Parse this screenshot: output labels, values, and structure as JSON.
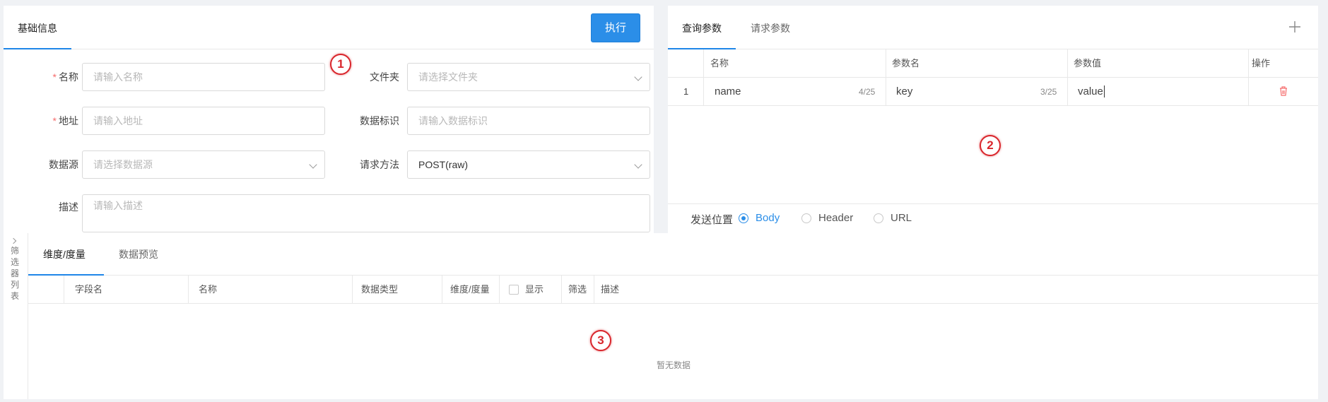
{
  "left_panel": {
    "tab": "基础信息",
    "execute_button": "执行",
    "fields": {
      "name": {
        "label": "名称",
        "required_mark": "*",
        "placeholder": "请输入名称"
      },
      "folder": {
        "label": "文件夹",
        "placeholder": "请选择文件夹"
      },
      "address": {
        "label": "地址",
        "required_mark": "*",
        "placeholder": "请输入地址"
      },
      "data_id": {
        "label": "数据标识",
        "placeholder": "请输入数据标识"
      },
      "datasource": {
        "label": "数据源",
        "placeholder": "请选择数据源"
      },
      "method": {
        "label": "请求方法",
        "value": "POST(raw)"
      },
      "description": {
        "label": "描述",
        "placeholder": "请输入描述"
      }
    }
  },
  "right_panel": {
    "tabs": [
      "查询参数",
      "请求参数"
    ],
    "add_icon": "plus-icon",
    "columns": [
      "名称",
      "参数名",
      "参数值",
      "操作"
    ],
    "rows": [
      {
        "index": "1",
        "name": "name",
        "name_count": "4/25",
        "param": "key",
        "param_count": "3/25",
        "value": "value"
      }
    ],
    "delete_icon": "trash-icon",
    "send_position": {
      "label": "发送位置",
      "options": [
        "Body",
        "Header",
        "URL"
      ],
      "selected": "Body"
    }
  },
  "bottom_panel": {
    "side_toggle": "筛选器列表",
    "tabs": [
      "维度/度量",
      "数据预览"
    ],
    "columns": [
      "字段名",
      "名称",
      "数据类型",
      "维度/度量",
      "显示",
      "筛选",
      "描述"
    ],
    "empty_text": "暂无数据"
  },
  "markers": [
    "1",
    "2",
    "3"
  ],
  "colors": {
    "accent": "#2b8ee8",
    "danger": "#f56c6c",
    "marker": "#d9262c"
  }
}
